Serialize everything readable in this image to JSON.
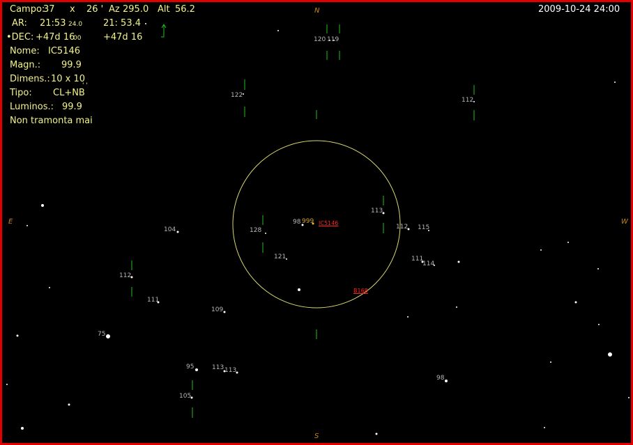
{
  "info_panel": {
    "campo_label": "Campo:",
    "campo_w": "37",
    "campo_x": "x",
    "campo_h": "26 '",
    "az_label": "Az",
    "az_value": "295.0",
    "alt_label": "Alt",
    "alt_value": "56.2",
    "ar_label": "AR:",
    "ar_value": "21:53",
    "ar_small": "24.0",
    "ar_value2": "21: 53.4",
    "dec_label": "•DEC:",
    "dec_value": "+47d 16",
    "dec_small": "00",
    "dec_value2": "+47d 16",
    "nome_label": "Nome:",
    "nome_value": "IC5146",
    "magn_label": "Magn.:",
    "magn_value": "99.9",
    "dimens_label": "Dimens.:",
    "dimens_value": "10 x 10",
    "dimens_unit": "' '",
    "tipo_label": "Tipo:",
    "tipo_value": "CL+NB",
    "luminos_label": "Luminos.:",
    "luminos_value": "99.9",
    "visibility": "Non tramonta mai"
  },
  "datetime": "2009-10-24  24:00",
  "cardinal": {
    "north": "N",
    "south": "S",
    "east": "E",
    "west": "W"
  },
  "objects": {
    "target": "IC5146",
    "other": "B168",
    "target_mag": "999"
  },
  "star_labels": [
    "120",
    "119",
    "122",
    "112",
    "113",
    "98",
    "128",
    "112",
    "115",
    "104",
    "121",
    "111",
    "114",
    "112",
    "111",
    "109",
    "75",
    "95",
    "113",
    "113",
    "105",
    "98"
  ],
  "colors": {
    "background": "#000000",
    "frame": "#e00000",
    "info_text": "#f2f28a",
    "label": "#b8b8b8",
    "circle": "#d8d870",
    "marker": "#1fbf1f",
    "object": "#ff2020",
    "cardinal": "#c8881a"
  },
  "icons": {
    "altitude_arrow": "up-arrow-icon"
  }
}
